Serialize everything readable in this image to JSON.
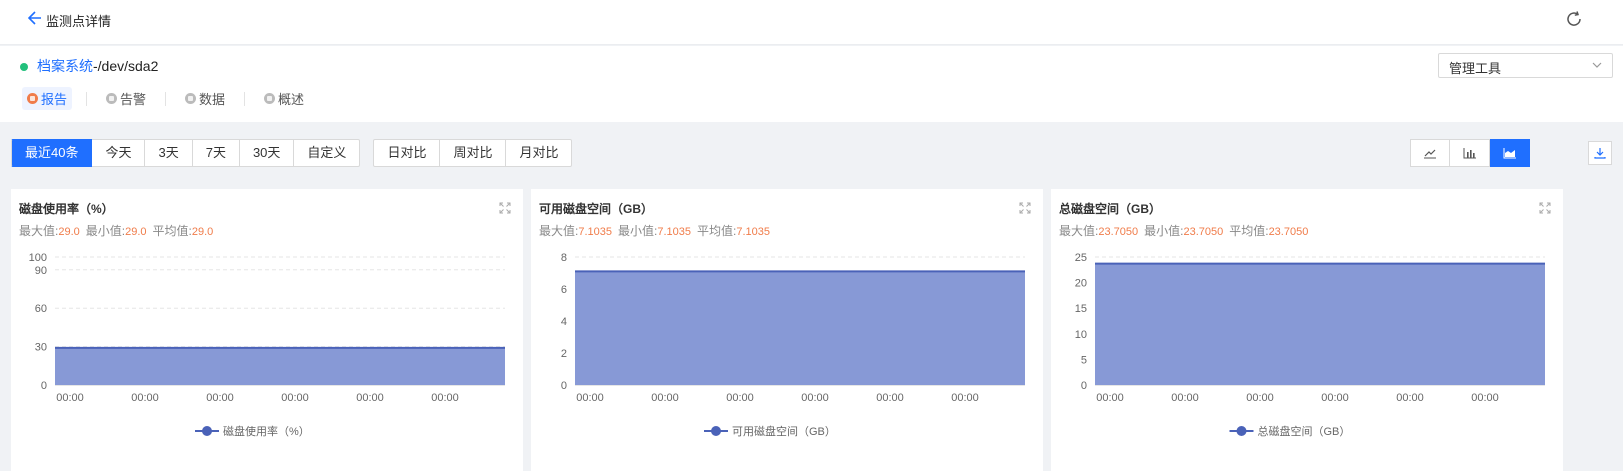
{
  "header": {
    "title": "监测点详情",
    "back_icon": "arrow-left-icon",
    "refresh_icon": "refresh-icon"
  },
  "resource": {
    "status_color": "#22c07c",
    "link_text": "档案系统",
    "path_text": "-/dev/sda2"
  },
  "tool_select": {
    "value": "管理工具"
  },
  "tabs": [
    {
      "label": "报告",
      "active": true
    },
    {
      "label": "告警",
      "active": false
    },
    {
      "label": "数据",
      "active": false
    },
    {
      "label": "概述",
      "active": false
    }
  ],
  "range_buttons": [
    "最近40条",
    "今天",
    "3天",
    "7天",
    "30天",
    "自定义"
  ],
  "compare_buttons": [
    "日对比",
    "周对比",
    "月对比"
  ],
  "view_buttons": [
    "line-chart-icon",
    "bar-chart-icon",
    "area-chart-icon"
  ],
  "colors": {
    "accent": "#1f6fff",
    "area_fill": "#8799d6",
    "area_line": "#4a62b8",
    "stat_value": "#f07c4a"
  },
  "stat_labels": {
    "max": "最大值:",
    "min": "最小值:",
    "avg": "平均值:"
  },
  "panels": [
    {
      "title": "磁盘使用率（%）",
      "max": "29.0",
      "min": "29.0",
      "avg": "29.0",
      "legend": "磁盘使用率（%）"
    },
    {
      "title": "可用磁盘空间（GB）",
      "max": "7.1035",
      "min": "7.1035",
      "avg": "7.1035",
      "legend": "可用磁盘空间（GB）"
    },
    {
      "title": "总磁盘空间（GB）",
      "max": "23.7050",
      "min": "23.7050",
      "avg": "23.7050",
      "legend": "总磁盘空间（GB）"
    }
  ],
  "chart_data": [
    {
      "type": "area",
      "title": "磁盘使用率（%）",
      "x": [
        "00:00",
        "00:00",
        "00:00",
        "00:00",
        "00:00",
        "00:00"
      ],
      "series": [
        {
          "name": "磁盘使用率（%）",
          "values": [
            29.0,
            29.0,
            29.0,
            29.0,
            29.0,
            29.0
          ]
        }
      ],
      "yticks": [
        0,
        30,
        60,
        90,
        100
      ],
      "ylim": [
        0,
        100
      ],
      "grid": true,
      "legend": "bottom-center"
    },
    {
      "type": "area",
      "title": "可用磁盘空间（GB）",
      "x": [
        "00:00",
        "00:00",
        "00:00",
        "00:00",
        "00:00",
        "00:00"
      ],
      "series": [
        {
          "name": "可用磁盘空间（GB）",
          "values": [
            7.1035,
            7.1035,
            7.1035,
            7.1035,
            7.1035,
            7.1035
          ]
        }
      ],
      "yticks": [
        0,
        2,
        4,
        6,
        8
      ],
      "ylim": [
        0,
        8
      ],
      "grid": true,
      "legend": "bottom-center"
    },
    {
      "type": "area",
      "title": "总磁盘空间（GB）",
      "x": [
        "00:00",
        "00:00",
        "00:00",
        "00:00",
        "00:00",
        "00:00"
      ],
      "series": [
        {
          "name": "总磁盘空间（GB）",
          "values": [
            23.705,
            23.705,
            23.705,
            23.705,
            23.705,
            23.705
          ]
        }
      ],
      "yticks": [
        0,
        5,
        10,
        15,
        20,
        25
      ],
      "ylim": [
        0,
        25
      ],
      "grid": true,
      "legend": "bottom-center"
    }
  ]
}
